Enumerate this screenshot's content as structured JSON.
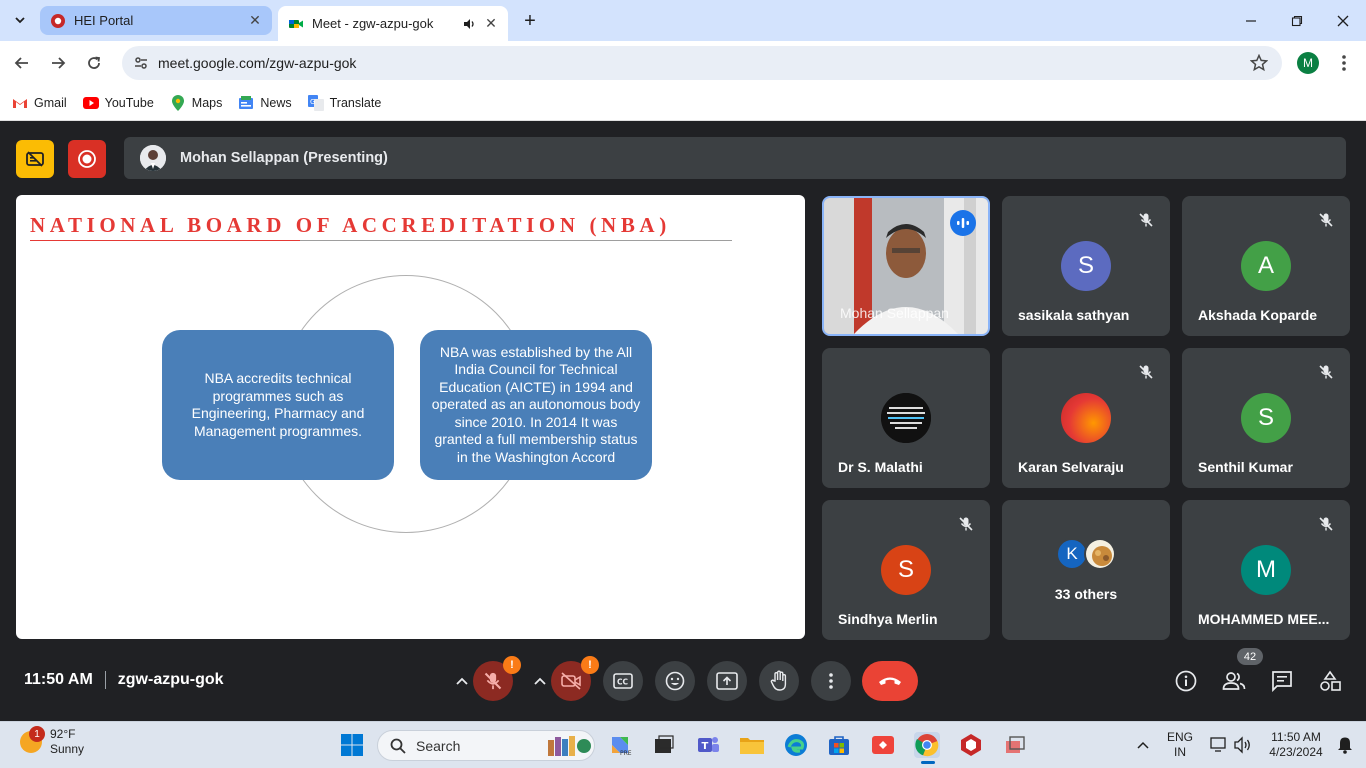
{
  "browser": {
    "tabs": [
      {
        "title": "HEI Portal",
        "active": false
      },
      {
        "title": "Meet - zgw-azpu-gok",
        "active": true
      }
    ],
    "url": "meet.google.com/zgw-azpu-gok",
    "profile_initial": "M",
    "bookmarks": [
      "Gmail",
      "YouTube",
      "Maps",
      "News",
      "Translate"
    ]
  },
  "meet": {
    "presenting_label": "Mohan Sellappan (Presenting)",
    "slide": {
      "title": "NATIONAL BOARD OF ACCREDITATION (NBA)",
      "left_box": "NBA accredits technical programmes such as Engineering, Pharmacy  and Management programmes.",
      "right_box": "NBA was established by the All India Council for Technical Education (AICTE) in 1994 and operated as an autonomous body since 2010. In 2014 It was granted a full membership status in the Washington Accord"
    },
    "participants": [
      {
        "name": "Mohan Sellappan",
        "initial": "",
        "color": "#8a8f94"
      },
      {
        "name": "sasikala sathyan",
        "initial": "S",
        "color": "#5c6bc0"
      },
      {
        "name": "Akshada Koparde",
        "initial": "A",
        "color": "#43a047"
      },
      {
        "name": "Dr S. Malathi",
        "initial": "",
        "color": "#111111"
      },
      {
        "name": "Karan Selvaraju",
        "initial": "",
        "color": "#e53935"
      },
      {
        "name": "Senthil Kumar",
        "initial": "S",
        "color": "#43a047"
      },
      {
        "name": "Sindhya Merlin",
        "initial": "S",
        "color": "#d84315"
      },
      {
        "name": "33 others",
        "initial": "K",
        "color": "#1565c0"
      },
      {
        "name": "MOHAMMED MEE...",
        "initial": "M",
        "color": "#00897b"
      }
    ],
    "time": "11:50 AM",
    "meeting_code": "zgw-azpu-gok",
    "participant_count": "42",
    "warn_mark": "!"
  },
  "taskbar": {
    "weather_temp": "92°F",
    "weather_desc": "Sunny",
    "weather_badge": "1",
    "search_label": "Search",
    "lang_top": "ENG",
    "lang_bottom": "IN",
    "time": "11:50 AM",
    "date": "4/23/2024"
  },
  "colors": {
    "meet_bg": "#202124",
    "end_call": "#ea4335",
    "slide_title": "#e53935",
    "slide_box": "#4a7fb8"
  }
}
